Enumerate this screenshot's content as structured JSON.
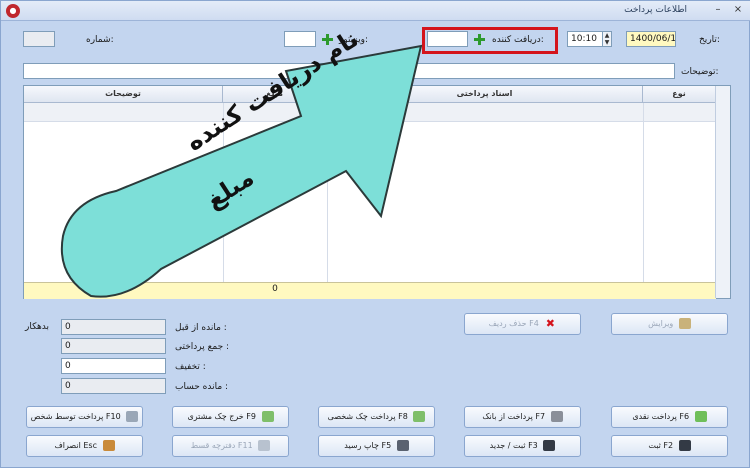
{
  "window": {
    "title": "اطلاعات پرداخت",
    "minimize": "–",
    "close": "×"
  },
  "header": {
    "date_label": "تاریخ:",
    "date_value": "1400/06/17",
    "time_value": "10:10",
    "receiver_label": "دریافت کننده:",
    "visitor_label": "ویزیتور:",
    "number_label": "شماره:",
    "description_label": "توضیحات:"
  },
  "grid": {
    "columns": [
      "نوع",
      "اسناد پرداختی",
      "مبلغ",
      "توضیحات"
    ],
    "footer_amount": "0"
  },
  "annotation": {
    "line1": "نام دریافت کننده",
    "line2": "مبلغ"
  },
  "summary": {
    "prev_balance_label": "مانده از قبل :",
    "prev_balance_value": "0",
    "prev_balance_status": "بدهکار",
    "total_paid_label": "جمع پرداختی :",
    "total_paid_value": "0",
    "discount_label": "تخفیف :",
    "discount_value": "0",
    "account_balance_label": "مانده حساب :",
    "account_balance_value": "0"
  },
  "buttons": {
    "edit": "ویرایش",
    "delete_row": "حذف ردیف F4",
    "cash_payment": "پرداخت نقدی F6",
    "bank_payment": "پرداخت از بانک F7",
    "personal_check": "پرداخت چک شخصی F8",
    "customer_check": "خرج چک مشتری F9",
    "pay_by_person": "پرداخت توسط شخص F10",
    "save": "ثبت F2",
    "save_new": "ثبت / جدید F3",
    "print_receipt": "چاپ رسید F5",
    "installment_book": "دفترچه قسط F11",
    "cancel": "انصراف Esc"
  },
  "colors": {
    "accent_red": "#d4141c",
    "arrow_teal": "#7ddfd8"
  }
}
